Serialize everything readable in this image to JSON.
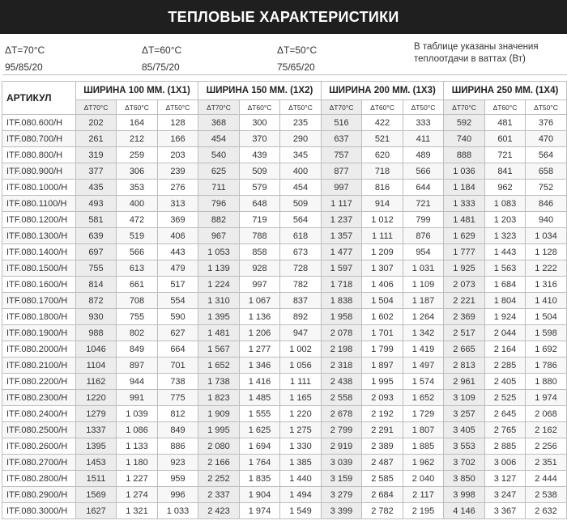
{
  "title": "ТЕПЛОВЫЕ ХАРАКТЕРИСТИКИ",
  "modes": [
    {
      "dt": "ΔT=70°С",
      "temps": "95/85/20"
    },
    {
      "dt": "ΔT=60°С",
      "temps": "85/75/20"
    },
    {
      "dt": "ΔT=50°С",
      "temps": "75/65/20"
    }
  ],
  "note": "В таблице указаны значения теплоотдачи в ваттах (Вт)",
  "table": {
    "article_header": "АРТИКУЛ",
    "groups": [
      "ШИРИНА 100 ММ. (1Х1)",
      "ШИРИНА 150 ММ. (1Х2)",
      "ШИРИНА 200 ММ. (1Х3)",
      "ШИРИНА 250 ММ. (1Х4)"
    ],
    "subheaders": [
      "ΔT70°С",
      "ΔT60°С",
      "ΔT50°С"
    ],
    "rows": [
      [
        "ITF.080.600/H",
        "202",
        "164",
        "128",
        "368",
        "300",
        "235",
        "516",
        "422",
        "333",
        "592",
        "481",
        "376"
      ],
      [
        "ITF.080.700/H",
        "261",
        "212",
        "166",
        "454",
        "370",
        "290",
        "637",
        "521",
        "411",
        "740",
        "601",
        "470"
      ],
      [
        "ITF.080.800/H",
        "319",
        "259",
        "203",
        "540",
        "439",
        "345",
        "757",
        "620",
        "489",
        "888",
        "721",
        "564"
      ],
      [
        "ITF.080.900/H",
        "377",
        "306",
        "239",
        "625",
        "509",
        "400",
        "877",
        "718",
        "566",
        "1 036",
        "841",
        "658"
      ],
      [
        "ITF.080.1000/H",
        "435",
        "353",
        "276",
        "711",
        "579",
        "454",
        "997",
        "816",
        "644",
        "1 184",
        "962",
        "752"
      ],
      [
        "ITF.080.1100/H",
        "493",
        "400",
        "313",
        "796",
        "648",
        "509",
        "1 117",
        "914",
        "721",
        "1 333",
        "1 083",
        "846"
      ],
      [
        "ITF.080.1200/H",
        "581",
        "472",
        "369",
        "882",
        "719",
        "564",
        "1 237",
        "1 012",
        "799",
        "1 481",
        "1 203",
        "940"
      ],
      [
        "ITF.080.1300/H",
        "639",
        "519",
        "406",
        "967",
        "788",
        "618",
        "1 357",
        "1 111",
        "876",
        "1 629",
        "1 323",
        "1 034"
      ],
      [
        "ITF.080.1400/H",
        "697",
        "566",
        "443",
        "1 053",
        "858",
        "673",
        "1 477",
        "1 209",
        "954",
        "1 777",
        "1 443",
        "1 128"
      ],
      [
        "ITF.080.1500/H",
        "755",
        "613",
        "479",
        "1 139",
        "928",
        "728",
        "1 597",
        "1 307",
        "1 031",
        "1 925",
        "1 563",
        "1 222"
      ],
      [
        "ITF.080.1600/H",
        "814",
        "661",
        "517",
        "1 224",
        "997",
        "782",
        "1 718",
        "1 406",
        "1 109",
        "2 073",
        "1 684",
        "1 316"
      ],
      [
        "ITF.080.1700/H",
        "872",
        "708",
        "554",
        "1 310",
        "1 067",
        "837",
        "1 838",
        "1 504",
        "1 187",
        "2 221",
        "1 804",
        "1 410"
      ],
      [
        "ITF.080.1800/H",
        "930",
        "755",
        "590",
        "1 395",
        "1 136",
        "892",
        "1 958",
        "1 602",
        "1 264",
        "2 369",
        "1 924",
        "1 504"
      ],
      [
        "ITF.080.1900/H",
        "988",
        "802",
        "627",
        "1 481",
        "1 206",
        "947",
        "2 078",
        "1 701",
        "1 342",
        "2 517",
        "2 044",
        "1 598"
      ],
      [
        "ITF.080.2000/H",
        "1046",
        "849",
        "664",
        "1 567",
        "1 277",
        "1 002",
        "2 198",
        "1 799",
        "1 419",
        "2 665",
        "2 164",
        "1 692"
      ],
      [
        "ITF.080.2100/H",
        "1104",
        "897",
        "701",
        "1 652",
        "1 346",
        "1 056",
        "2 318",
        "1 897",
        "1 497",
        "2 813",
        "2 285",
        "1 786"
      ],
      [
        "ITF.080.2200/H",
        "1162",
        "944",
        "738",
        "1 738",
        "1 416",
        "1 111",
        "2 438",
        "1 995",
        "1 574",
        "2 961",
        "2 405",
        "1 880"
      ],
      [
        "ITF.080.2300/H",
        "1220",
        "991",
        "775",
        "1 823",
        "1 485",
        "1 165",
        "2 558",
        "2 093",
        "1 652",
        "3 109",
        "2 525",
        "1 974"
      ],
      [
        "ITF.080.2400/H",
        "1279",
        "1 039",
        "812",
        "1 909",
        "1 555",
        "1 220",
        "2 678",
        "2 192",
        "1 729",
        "3 257",
        "2 645",
        "2 068"
      ],
      [
        "ITF.080.2500/H",
        "1337",
        "1 086",
        "849",
        "1 995",
        "1 625",
        "1 275",
        "2 799",
        "2 291",
        "1 807",
        "3 405",
        "2 765",
        "2 162"
      ],
      [
        "ITF.080.2600/H",
        "1395",
        "1 133",
        "886",
        "2 080",
        "1 694",
        "1 330",
        "2 919",
        "2 389",
        "1 885",
        "3 553",
        "2 885",
        "2 256"
      ],
      [
        "ITF.080.2700/H",
        "1453",
        "1 180",
        "923",
        "2 166",
        "1 764",
        "1 385",
        "3 039",
        "2 487",
        "1 962",
        "3 702",
        "3 006",
        "2 351"
      ],
      [
        "ITF.080.2800/H",
        "1511",
        "1 227",
        "959",
        "2 252",
        "1 835",
        "1 440",
        "3 159",
        "2 585",
        "2 040",
        "3 850",
        "3 127",
        "2 444"
      ],
      [
        "ITF.080.2900/H",
        "1569",
        "1 274",
        "996",
        "2 337",
        "1 904",
        "1 494",
        "3 279",
        "2 684",
        "2 117",
        "3 998",
        "3 247",
        "2 538"
      ],
      [
        "ITF.080.3000/H",
        "1627",
        "1 321",
        "1 033",
        "2 423",
        "1 974",
        "1 549",
        "3 399",
        "2 782",
        "2 195",
        "4 146",
        "3 367",
        "2 632"
      ]
    ]
  }
}
